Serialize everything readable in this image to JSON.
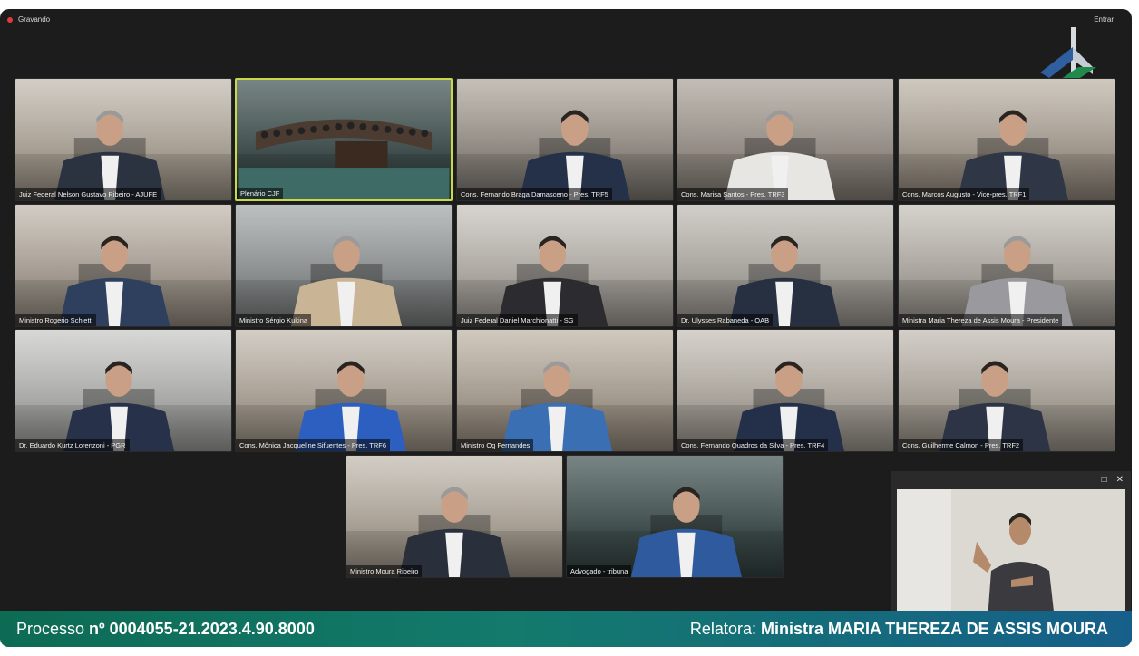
{
  "window": {
    "recording_label": "Gravando",
    "join_label": "Entrar"
  },
  "tiles": [
    {
      "label": "Juiz Federal Nelson Gustavo Ribeiro - AJUFE",
      "active": false
    },
    {
      "label": "Plenário CJF",
      "active": true
    },
    {
      "label": "Cons. Fernando Braga Damasceno - Pres. TRF5",
      "active": false
    },
    {
      "label": "Cons. Marisa Santos - Pres. TRF3",
      "active": false
    },
    {
      "label": "Cons. Marcos Augusto - Vice-pres. TRF1",
      "active": false
    },
    {
      "label": "Ministro Rogerio Schietti",
      "active": false
    },
    {
      "label": "Ministro Sérgio Kukina",
      "active": false
    },
    {
      "label": "Juiz Federal Daniel Marchionatti - SG",
      "active": false
    },
    {
      "label": "Dr. Ulysses Rabaneda - OAB",
      "active": false
    },
    {
      "label": "Ministra Maria Thereza de Assis Moura - Presidente",
      "active": false
    },
    {
      "label": "Dr. Eduardo Kurtz Lorenzoni - PGR",
      "active": false
    },
    {
      "label": "Cons. Mônica Jacqueline Sifuentes - Pres. TRF6",
      "active": false
    },
    {
      "label": "Ministro Og Fernandes",
      "active": false
    },
    {
      "label": "Cons. Fernando Quadros da Silva - Pres. TRF4",
      "active": false
    },
    {
      "label": "Cons. Guilherme Calmon - Pres. TRF2",
      "active": false
    },
    {
      "label": "Ministro Moura Ribeiro",
      "active": false
    },
    {
      "label": "Advogado - tribuna",
      "active": false
    }
  ],
  "caption": {
    "process_prefix": "Processo ",
    "process_number": "nº 0004055-21.2023.4.90.8000",
    "relator_prefix": "Relatora: ",
    "relator_name": "Ministra MARIA THEREZA DE ASSIS MOURA"
  },
  "sign_panel": {
    "maximize_icon": "maximize-icon",
    "close_icon": "close-icon"
  },
  "colors": {
    "active_border": "#c9d94a",
    "recording_dot": "#e23b3b",
    "caption_left": "#0d6b54",
    "caption_right": "#165f8a"
  }
}
